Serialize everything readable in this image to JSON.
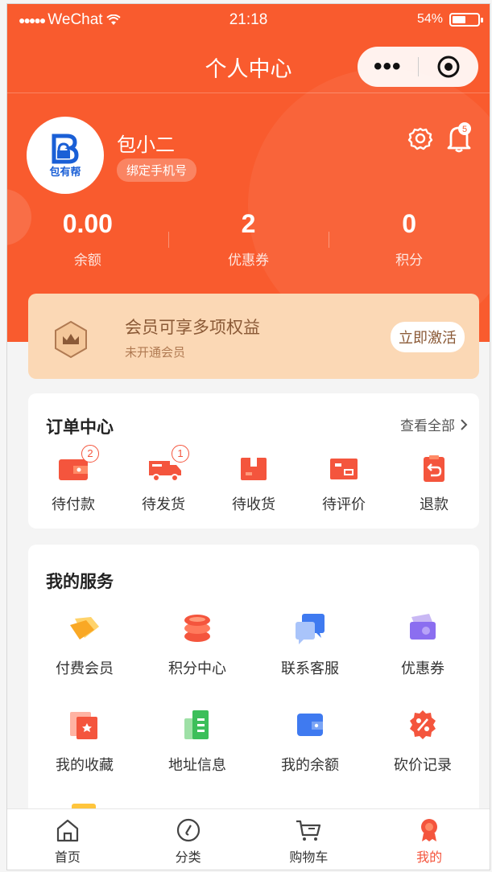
{
  "status_bar": {
    "carrier": "WeChat",
    "time": "21:18",
    "battery": "54%",
    "battery_level": 0.54
  },
  "nav": {
    "title": "个人中心",
    "more": "•••"
  },
  "profile": {
    "logo_text": "包有帮",
    "username": "包小二",
    "bind_phone": "绑定手机号",
    "notification_count": "5"
  },
  "stats": [
    {
      "value": "0.00",
      "label": "余额"
    },
    {
      "value": "2",
      "label": "优惠券"
    },
    {
      "value": "0",
      "label": "积分"
    }
  ],
  "membership": {
    "title": "会员可享多项权益",
    "subtitle": "未开通会员",
    "button": "立即激活"
  },
  "orders": {
    "title": "订单中心",
    "see_all": "查看全部",
    "items": [
      {
        "label": "待付款",
        "count": "2",
        "icon": "wallet-icon"
      },
      {
        "label": "待发货",
        "count": "1",
        "icon": "truck-icon"
      },
      {
        "label": "待收货",
        "count": "",
        "icon": "package-icon"
      },
      {
        "label": "待评价",
        "count": "",
        "icon": "review-icon"
      },
      {
        "label": "退款",
        "count": "",
        "icon": "refund-icon"
      }
    ]
  },
  "services": {
    "title": "我的服务",
    "items": [
      {
        "label": "付费会员",
        "icon": "diamond-icon"
      },
      {
        "label": "积分中心",
        "icon": "coins-icon"
      },
      {
        "label": "联系客服",
        "icon": "chat-icon"
      },
      {
        "label": "优惠券",
        "icon": "ticket-icon"
      },
      {
        "label": "我的收藏",
        "icon": "favorite-icon"
      },
      {
        "label": "地址信息",
        "icon": "address-icon"
      },
      {
        "label": "我的余额",
        "icon": "balance-icon"
      },
      {
        "label": "砍价记录",
        "icon": "discount-icon"
      }
    ]
  },
  "tabbar": [
    {
      "label": "首页",
      "icon": "home-icon"
    },
    {
      "label": "分类",
      "icon": "category-icon"
    },
    {
      "label": "购物车",
      "icon": "cart-icon"
    },
    {
      "label": "我的",
      "icon": "user-icon",
      "active": true
    }
  ],
  "colors": {
    "primary": "#f95b2e",
    "accent_red": "#f4553d",
    "member_bg": "#fbd8b5",
    "member_text": "#8b5a37"
  }
}
